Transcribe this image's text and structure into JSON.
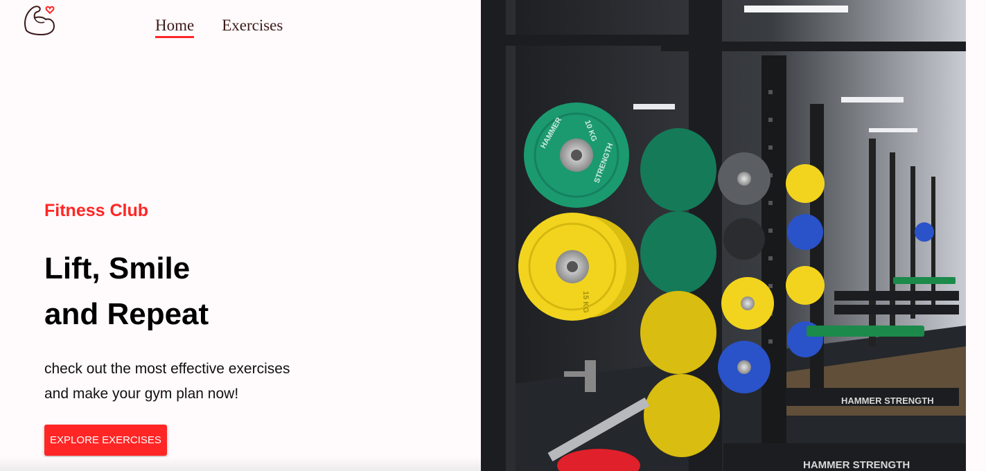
{
  "nav": {
    "logo_icon": "flexed-arm-heart-icon",
    "items": [
      {
        "label": "Home",
        "active": true
      },
      {
        "label": "Exercises",
        "active": false
      }
    ]
  },
  "hero": {
    "eyebrow": "Fitness Club",
    "headline_line1": "Lift, Smile",
    "headline_line2": "and Repeat",
    "sub_line1": "check out the most effective exercises",
    "sub_line2": "and make your gym plan now!",
    "cta_label": "EXPLORE EXERCISES"
  },
  "banner": {
    "plate_labels": [
      "HAMMER",
      "STRENGTH",
      "10 KG",
      "15 KG"
    ],
    "rack_brand": "HAMMER STRENGTH"
  },
  "colors": {
    "accent": "#ff2625",
    "background": "#fffafb",
    "plate_green": "#1b9a6f",
    "plate_yellow": "#f2d41e",
    "plate_blue": "#2a52c9"
  }
}
